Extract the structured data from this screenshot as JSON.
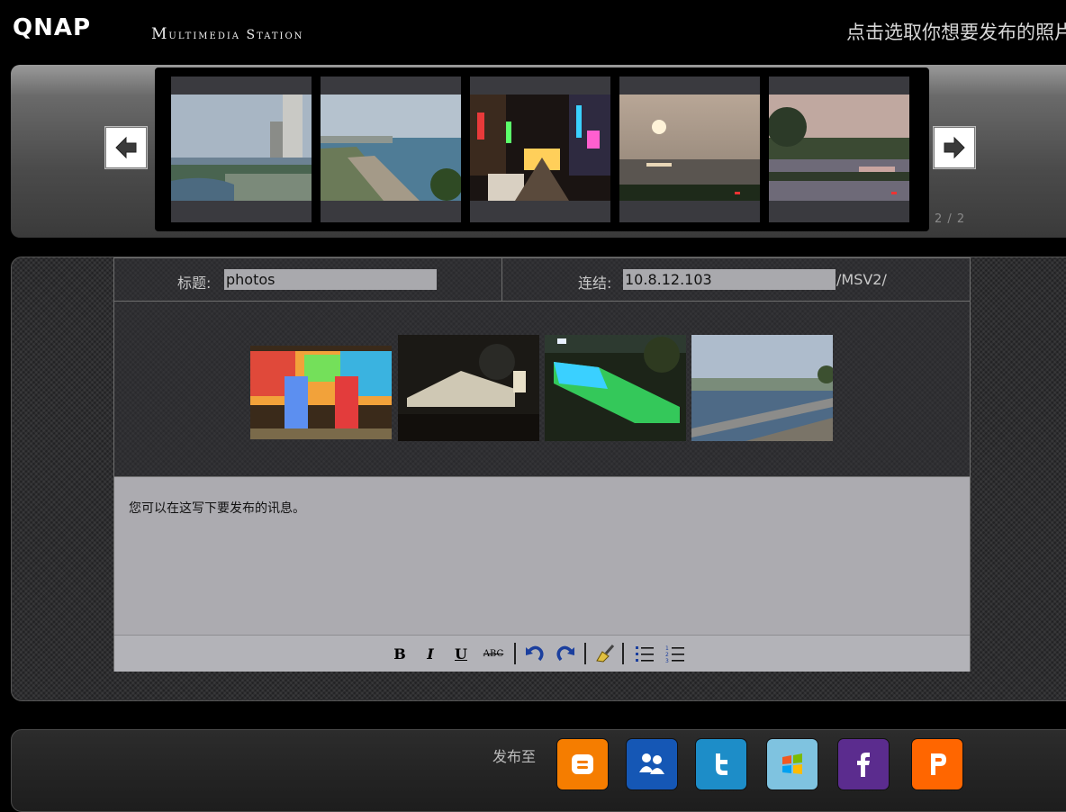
{
  "header": {
    "logo": "QNAP",
    "app_name": "Multimedia Station",
    "hint": "点击选取你想要发布的照片"
  },
  "strip": {
    "page_counter": "2 / 2",
    "photos": [
      "coast-city",
      "seaside-road",
      "night-market",
      "sunset-sea",
      "lake-dusk"
    ]
  },
  "form": {
    "title_label": "标题:",
    "title_value": "photos",
    "link_label": "连结:",
    "link_value": "10.8.12.103",
    "link_suffix": "/MSV2/",
    "selected_photos": [
      "light-tunnel",
      "night-tent",
      "green-pool",
      "harbor-day"
    ]
  },
  "editor": {
    "message": "您可以在这写下要发布的讯息。",
    "toolbar": {
      "bold": "B",
      "italic": "I",
      "underline": "U",
      "strikethrough": "ABC"
    }
  },
  "share": {
    "label": "发布至",
    "services": [
      {
        "name": "blogger",
        "glyph": "B",
        "color": "#f57d00"
      },
      {
        "name": "msn",
        "glyph": "",
        "color": "#1565c0"
      },
      {
        "name": "twitter",
        "glyph": "t",
        "color": "#1d8dc8"
      },
      {
        "name": "windows-live",
        "glyph": "",
        "color": "#7fc3e0"
      },
      {
        "name": "facebook",
        "glyph": "f",
        "color": "#5b2c8e"
      },
      {
        "name": "plurk",
        "glyph": "P",
        "color": "#ff6600"
      }
    ]
  }
}
